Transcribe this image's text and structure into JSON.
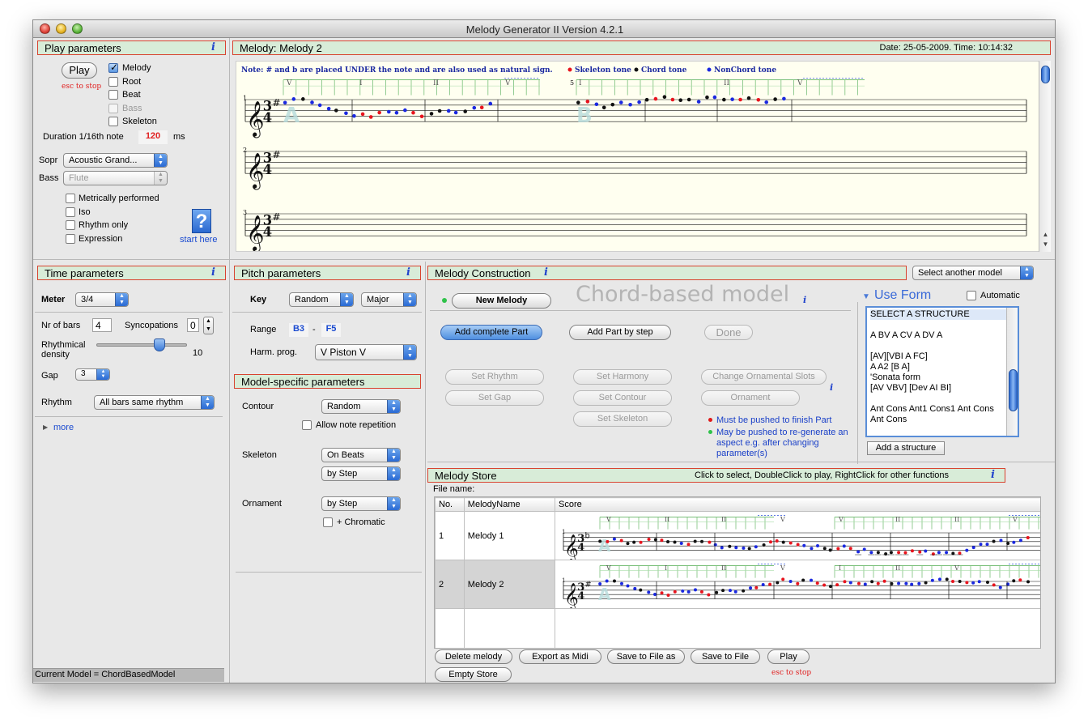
{
  "window": {
    "title": "Melody Generator II Version 4.2.1"
  },
  "play_params": {
    "title": "Play parameters",
    "info": "i",
    "play_label": "Play",
    "esc_label": "esc to stop",
    "checks": [
      {
        "label": "Melody",
        "checked": true,
        "enabled": true
      },
      {
        "label": "Root",
        "checked": false,
        "enabled": true
      },
      {
        "label": "Beat",
        "checked": false,
        "enabled": true
      },
      {
        "label": "Bass",
        "checked": false,
        "enabled": false
      },
      {
        "label": "Skeleton",
        "checked": false,
        "enabled": true
      }
    ],
    "duration_label": "Duration 1/16th note",
    "duration_value": "120",
    "duration_unit": "ms",
    "sopr_label": "Sopr",
    "sopr_value": "Acoustic Grand...",
    "bass_label": "Bass",
    "bass_value": "Flute",
    "options": [
      {
        "label": "Metrically performed",
        "checked": false
      },
      {
        "label": "Iso",
        "checked": false
      },
      {
        "label": "Rhythm only",
        "checked": false
      },
      {
        "label": "Expression",
        "checked": false
      }
    ],
    "help_glyph": "?",
    "start_here": "start here"
  },
  "melody_view": {
    "title": "Melody: Melody 2",
    "date": "Date: 25-05-2009. Time: 10:14:32",
    "note": "Note: # and b are placed UNDER the note and are also used as natural sign.",
    "legend": [
      {
        "label": "Skeleton tone",
        "color": "#e8141e"
      },
      {
        "label": "Chord tone",
        "color": "#111111"
      },
      {
        "label": "NonChord tone",
        "color": "#1a28e0"
      }
    ],
    "staves": [
      {
        "number": "1"
      },
      {
        "number": "2"
      },
      {
        "number": "3"
      }
    ],
    "chords_line1": [
      "V",
      "I",
      "II",
      "V",
      "I",
      "II",
      "V"
    ],
    "phrase_marks": [
      "5"
    ],
    "part_letters": [
      "A",
      "B"
    ],
    "time_sig_top": "3",
    "time_sig_bottom": "4",
    "clef": "𝄞",
    "sharp": "#"
  },
  "time_params": {
    "title": "Time parameters",
    "info": "i",
    "meter_label": "Meter",
    "meter_value": "3/4",
    "nbars_label": "Nr of bars",
    "nbars_value": "4",
    "sync_label": "Syncopations",
    "sync_value": "0",
    "density_label": "Rhythmical density",
    "density_value": "10",
    "density_level": 0.7,
    "gap_label": "Gap",
    "gap_value": "3",
    "rhythm_label": "Rhythm",
    "rhythm_value": "All bars same rhythm",
    "more_label": "more",
    "current_model": "Current Model = ChordBasedModel"
  },
  "pitch_params": {
    "title": "Pitch parameters",
    "info": "i",
    "key_label": "Key",
    "key_value": "Random",
    "mode_value": "Major",
    "range_label": "Range",
    "range_low": "B3",
    "range_dash": "-",
    "range_high": "F5",
    "harm_label": "Harm. prog.",
    "harm_value": "V Piston V"
  },
  "model_params": {
    "title": "Model-specific parameters",
    "contour_label": "Contour",
    "contour_value": "Random",
    "allow_repeat": "Allow note repetition",
    "skeleton_label": "Skeleton",
    "skeleton_value1": "On Beats",
    "skeleton_value2": "by Step",
    "ornament_label": "Ornament",
    "ornament_value": "by Step",
    "chromatic_label": "+ Chromatic"
  },
  "construction": {
    "title": "Melody Construction",
    "info": "i",
    "select_model": "Select another model",
    "new_melody": "New Melody",
    "model_name": "Chord-based model",
    "model_info": "i",
    "add_complete": "Add complete Part",
    "add_step": "Add Part by step",
    "done": "Done",
    "set_rhythm": "Set Rhythm",
    "set_harmony": "Set Harmony",
    "change_slots": "Change Ornamental Slots",
    "set_gap": "Set Gap",
    "set_contour": "Set Contour",
    "ornament": "Ornament",
    "set_skeleton": "Set Skeleton",
    "legend_info": "i",
    "legend_red": "Must be pushed to finish Part",
    "legend_green": "May be pushed to re-generate an aspect e.g. after changing parameter(s)",
    "use_form": "Use Form",
    "automatic": "Automatic",
    "structures": [
      "SELECT A STRUCTURE",
      "",
      "A BV A CV A DV A",
      "",
      "[AV][VBI A FC]",
      "A A2 [B A]",
      "'Sonata form",
      "[AV VBV] [Dev AI BI]",
      "",
      "Ant Cons Ant1 Cons1 Ant Cons",
      "Ant Cons"
    ],
    "add_structure": "Add a structure"
  },
  "store": {
    "title": "Melody Store",
    "hint": "Click to select, DoubleClick to play, RightClick for other functions",
    "info": "i",
    "file_label": "File name:",
    "columns": [
      "No.",
      "MelodyName",
      "Score"
    ],
    "rows": [
      {
        "no": "1",
        "name": "Melody 1"
      },
      {
        "no": "2",
        "name": "Melody 2"
      }
    ],
    "row1_chords": [
      "V",
      "II",
      "II",
      "V",
      "V",
      "II",
      "II",
      "V"
    ],
    "row2_chords": [
      "V",
      "I",
      "II",
      "V",
      "I",
      "II",
      "V"
    ],
    "buttons": [
      "Delete melody",
      "Export as Midi",
      "Save to File as",
      "Save to File",
      "Play"
    ],
    "empty_store": "Empty Store",
    "esc_label": "esc to stop"
  }
}
